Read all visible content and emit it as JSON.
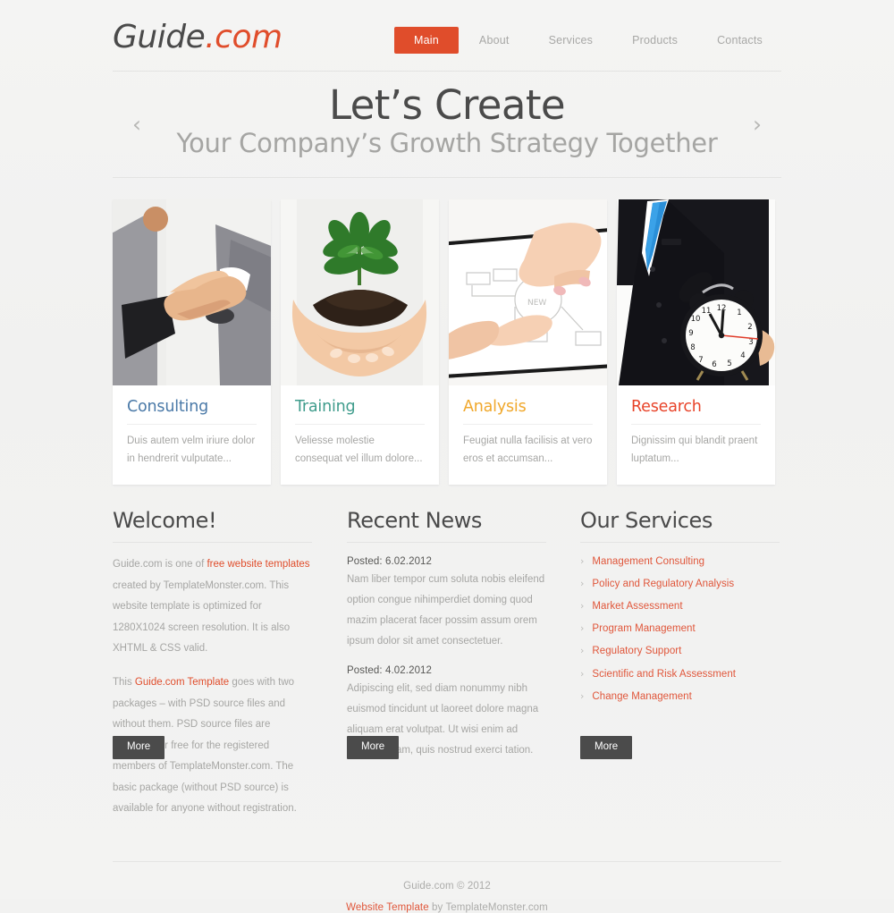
{
  "site": {
    "logo_main": "Guide",
    "logo_tld": ".com",
    "accent_color": "#e04d2b"
  },
  "nav": {
    "items": [
      {
        "label": "Main",
        "active": true
      },
      {
        "label": "About",
        "active": false
      },
      {
        "label": "Services",
        "active": false
      },
      {
        "label": "Products",
        "active": false
      },
      {
        "label": "Contacts",
        "active": false
      }
    ]
  },
  "slider": {
    "title": "Let’s Create",
    "subtitle": "Your Company’s Growth Strategy Together",
    "prev_arrow": "‹",
    "next_arrow": "›"
  },
  "cards": [
    {
      "title": "Consulting",
      "title_color": "#4b7aa8",
      "text": "Duis autem velm iriure dolor in hendrerit vulputate...",
      "image_name": "handshake-photo"
    },
    {
      "title": "Training",
      "title_color": "#3f9c8c",
      "text": "Veliesse molestie consequat vel illum dolore...",
      "image_name": "plant-in-hands-photo"
    },
    {
      "title": "Analysis",
      "title_color": "#f0a82c",
      "text": "Feugiat nulla facilisis at vero eros et accumsan...",
      "image_name": "hands-on-documents-photo"
    },
    {
      "title": "Research",
      "title_color": "#e8442a",
      "text": "Dignissim qui blandit praent luptatum...",
      "image_name": "businessman-with-clock-photo"
    }
  ],
  "welcome": {
    "heading": "Welcome!",
    "p1_before": "Guide.com is one of ",
    "p1_link": "free website templates",
    "p1_after": " created by TemplateMonster.com. This website template is optimized for 1280X1024 screen resolution. It is also XHTML & CSS valid.",
    "p2_before": "This ",
    "p2_link": "Guide.com Template",
    "p2_after": " goes with two pack­ages – with PSD source files and without them. PSD source files are available for free for the registered members of TemplateMonster.com. The basic package (without PSD source) is available for anyone without registration.",
    "more_label": "More"
  },
  "news": {
    "heading": "Recent News",
    "posts": [
      {
        "date_label": "Posted: 6.02.2012",
        "text": "Nam liber tempor cum soluta nobis eleifend option congue nihimperdiet doming quod mazim placerat facer possim assum orem ipsum dolor sit amet consectetuer."
      },
      {
        "date_label": "Posted: 4.02.2012",
        "text": "Adipiscing elit, sed diam nonummy nibh euismod tincidunt ut laoreet dolore magna aliquam erat volutpat. Ut wisi enim ad minim veniam, quis nostrud exerci tation."
      }
    ],
    "more_label": "More"
  },
  "services": {
    "heading": "Our Services",
    "chevron": "›",
    "items": [
      "Management Consulting",
      "Policy and Regulatory Analysis",
      "Market Assessment",
      "Program Management",
      "Regulatory Support",
      "Scientific and Risk Assessment",
      "Change Management"
    ],
    "more_label": "More"
  },
  "footer": {
    "copyright": "Guide.com © 2012",
    "credit_link": "Website Template",
    "credit_rest": " by TemplateMonster.com"
  }
}
